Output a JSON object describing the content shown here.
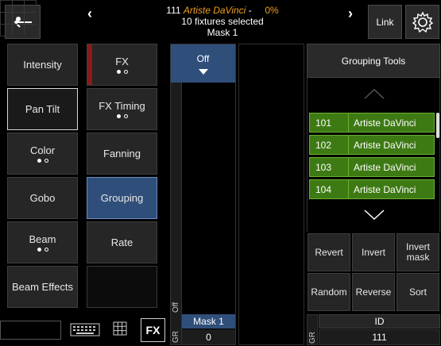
{
  "header": {
    "fixture_id": "111",
    "fixture_name": "Artiste DaVinci",
    "dash": "-",
    "percent": "0%",
    "fixtures_selected": "10 fixtures selected",
    "mask": "Mask 1",
    "link_label": "Link",
    "icons": {
      "back": "back-arrow-icon",
      "grid": "grid-position-icon",
      "prev": "chevron-left-icon",
      "next": "chevron-right-icon",
      "settings": "gear-icon"
    }
  },
  "left_buttons": [
    {
      "label": "Intensity",
      "dots": null
    },
    {
      "label": "FX",
      "dots": "filled-open"
    },
    {
      "label": "Pan Tilt",
      "dots": null
    },
    {
      "label": "FX Timing",
      "dots": "filled-open"
    },
    {
      "label": "Color",
      "dots": "filled-open"
    },
    {
      "label": "Fanning",
      "dots": null
    },
    {
      "label": "Gobo",
      "dots": null
    },
    {
      "label": "Grouping",
      "dots": null
    },
    {
      "label": "Beam",
      "dots": "filled-open"
    },
    {
      "label": "Rate",
      "dots": null
    },
    {
      "label": "Beam Effects",
      "dots": null
    },
    {
      "label": "",
      "dots": null
    }
  ],
  "fader": {
    "off_label": "Off",
    "side_label_off": "Off",
    "side_label_gr": "GR",
    "mask_label": "Mask 1",
    "mask_value": "0"
  },
  "grouping": {
    "title": "Grouping Tools",
    "rows": [
      {
        "num": "101",
        "name": "Artiste DaVinci"
      },
      {
        "num": "102",
        "name": "Artiste DaVinci"
      },
      {
        "num": "103",
        "name": "Artiste DaVinci"
      },
      {
        "num": "104",
        "name": "Artiste DaVinci"
      }
    ],
    "tools": [
      "Revert",
      "Invert",
      "Invert mask",
      "Random",
      "Reverse",
      "Sort"
    ],
    "gr_label": "GR",
    "id_header": "ID",
    "id_value": "111"
  },
  "footer": {
    "fx_label": "FX",
    "icons": {
      "keyboard": "keyboard-icon",
      "grid": "grid-icon"
    }
  },
  "colors": {
    "selected_blue": "#2f4f7a",
    "row_green": "#3e7a14",
    "accent_orange": "#f0a020",
    "fx_red": "#8a1a1a"
  }
}
